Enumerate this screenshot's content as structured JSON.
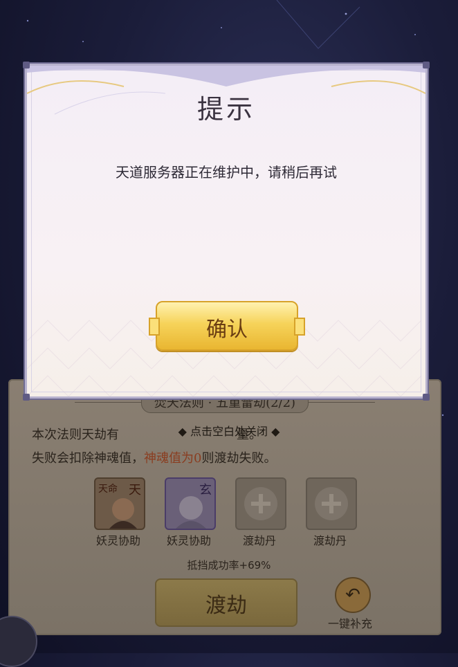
{
  "dialog": {
    "title": "提示",
    "message": "天道服务器正在维护中，请稍后再试",
    "confirm_label": "确认"
  },
  "panel": {
    "title": "焚天法则 · 五重雷劫(2/2)",
    "line1_a": "本次法则天劫有",
    "line1_b": "量。",
    "hint": "点击空白处关闭",
    "line2_a": "失败会扣除神魂值，",
    "line2_hl": "神魂值为0",
    "line2_b": "则渡劫失败。",
    "slots": [
      {
        "label": "妖灵协助",
        "badge": "天",
        "tag": "天命",
        "icon": "character-portrait-icon"
      },
      {
        "label": "妖灵协助",
        "badge": "玄",
        "icon": "character-portrait-icon"
      },
      {
        "label": "渡劫丹",
        "icon": "plus-icon"
      },
      {
        "label": "渡劫丹",
        "icon": "plus-icon"
      }
    ],
    "success_rate": "抵挡成功率+69%",
    "dujie_label": "渡劫",
    "refill_label": "一键补充",
    "refill_icon": "undo-arrow-icon"
  },
  "colors": {
    "accent_gold": "#f6d35a",
    "dialog_border": "#6f6b92",
    "highlight": "#8a3d20"
  }
}
